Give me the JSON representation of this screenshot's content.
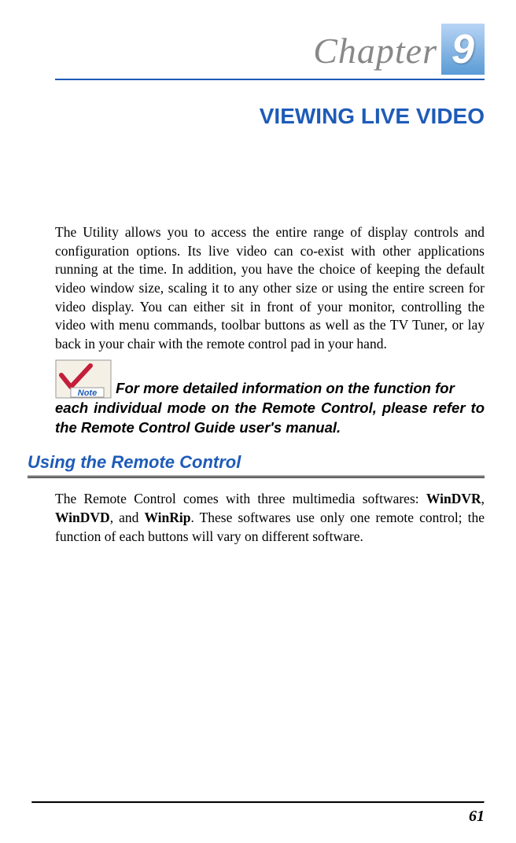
{
  "chapter": {
    "label": "Chapter",
    "number": "9"
  },
  "title": "VIEWING LIVE VIDEO",
  "paragraph1": "The Utility allows you to access the entire range of display controls and configuration options.  Its live video can co-exist with other applications running at the time.  In addition, you have the choice of keeping the default video window size, scaling it to any other size or using the entire screen for video display.  You can either sit in front of your monitor, controlling the video with menu commands, toolbar buttons as well as the TV Tuner, or lay back in your chair with the remote control pad in your hand.",
  "note": {
    "label": "Note",
    "text_inline": "For more detailed information on the function for",
    "text_continue": "each individual mode on the Remote Control, please refer to the Remote Control Guide user's manual."
  },
  "section_heading": "Using the Remote Control",
  "paragraph2_parts": {
    "p1": "The Remote Control comes with three multimedia softwares: ",
    "b1": "WinDVR",
    "p2": ", ",
    "b2": "WinDVD",
    "p3": ", and ",
    "b3": "WinRip",
    "p4": ". These softwares use only one remote control; the function of each buttons will vary on different software."
  },
  "page_number": "61"
}
